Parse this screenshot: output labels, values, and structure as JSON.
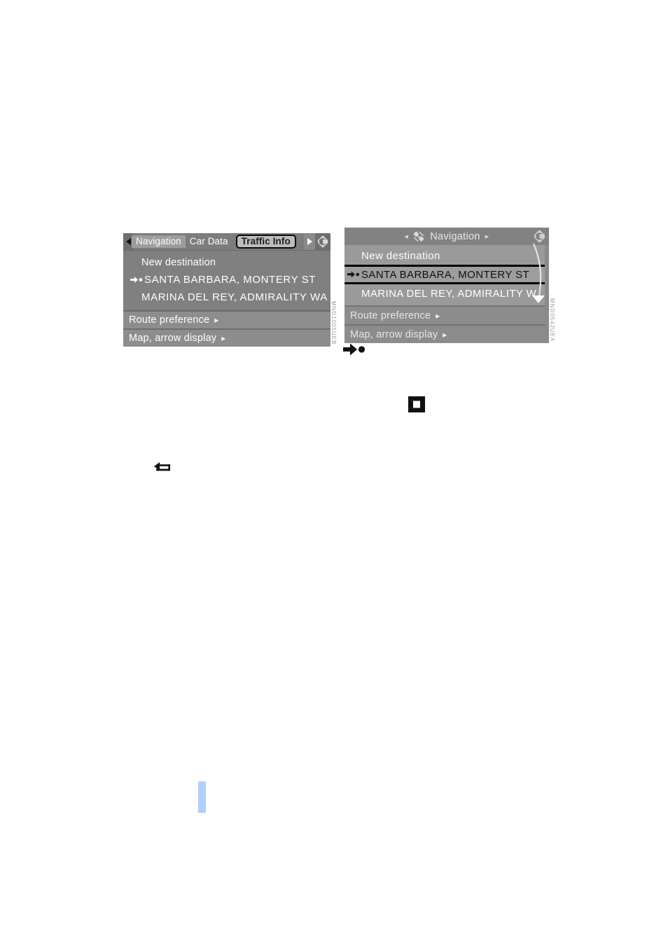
{
  "left_panel": {
    "name": "navigation-menu-tabbed",
    "tabs": [
      {
        "label": "Navigation",
        "state": "active-fill"
      },
      {
        "label": "Car Data",
        "state": "normal"
      },
      {
        "label": "Traffic Info",
        "state": "selected"
      }
    ],
    "prev_arrow_icon": "triangle-left-icon",
    "next_arrow_icon": "triangle-right-icon",
    "controller_icon": "nav-cross-controller-icon",
    "list": [
      {
        "label": "New destination",
        "marker": false,
        "caps": false
      },
      {
        "label": "SANTA BARBARA, MONTERY ST",
        "marker": true,
        "caps": true
      },
      {
        "label": "MARINA DEL REY, ADMIRALITY WA",
        "marker": false,
        "caps": true
      }
    ],
    "menu_rows": [
      {
        "label": "Route preference",
        "chevron": "▸"
      },
      {
        "label": "Map, arrow display",
        "chevron": "▸"
      }
    ],
    "figure_code": "MND1005UEB"
  },
  "right_panel": {
    "name": "navigation-menu-simple",
    "header": {
      "prev_arrow": "◂",
      "icon": "satellite-icon",
      "title": "Navigation",
      "next_arrow": "▸",
      "controller_icon": "nav-cross-controller-icon"
    },
    "list": [
      {
        "label": "New destination",
        "marker": false,
        "selected": false
      },
      {
        "label": "SANTA BARBARA, MONTERY ST",
        "marker": true,
        "selected": true
      },
      {
        "label": "MARINA DEL REY, ADMIRALITY W",
        "marker": false,
        "selected": false
      }
    ],
    "menu_rows": [
      {
        "label": "Route preference",
        "chevron": "▸"
      },
      {
        "label": "Map, arrow display",
        "chevron": "▸"
      }
    ],
    "scrollbar": {
      "down_arrow_icon": "scroll-down-triangle-icon"
    },
    "figure_code": "MND0542UEA"
  },
  "legend_icons": [
    {
      "name": "destination-arrow-dot-icon"
    },
    {
      "name": "select-confirm-button-icon"
    },
    {
      "name": "back-button-icon"
    }
  ],
  "colors": {
    "panel_bg": "#808080",
    "header_bg": "#7d7d7d",
    "menu_row_bg": "#8d8d8d",
    "selected_tab_fill": "#bdbdbd",
    "selected_tab_border": "#0a0a0a",
    "text_light": "#ffffff",
    "text_dark": "#111111",
    "margin_mark": "#aed0fb"
  }
}
